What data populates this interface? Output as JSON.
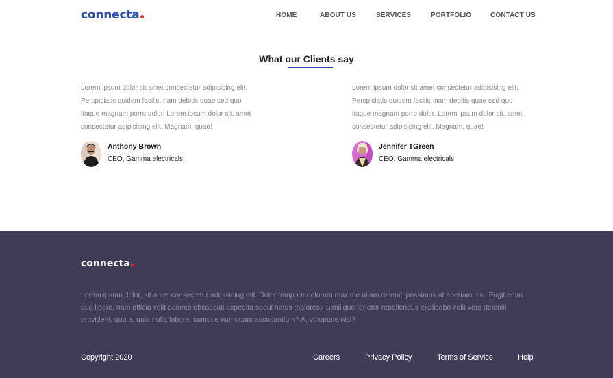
{
  "header": {
    "logo_text": "connecta",
    "nav": [
      {
        "label": "HOME"
      },
      {
        "label": "ABOUT US"
      },
      {
        "label": "SERVICES"
      },
      {
        "label": "PORTFOLIO"
      },
      {
        "label": "CONTACT US"
      }
    ]
  },
  "testimonials": {
    "title": "What our Clients say",
    "items": [
      {
        "quote": "Lorem ipsum dolor sit amet consectetur adipisicing elit. Perspiciatis quidem facilis, nam debitis quae sed quo itaque magnam porro dolor. Lorem ipsum dolor sit, amet consectetur adipisicing elit. Magnam, quae!",
        "name": "Anthony Brown",
        "role": "CEO, Gamma electricals"
      },
      {
        "quote": "Lorem ipsum dolor sit amet consectetur adipisicing elit. Perspiciatis quidem facilis, nam debitis quae sed quo itaque magnam porro dolor. Lorem ipsum dolor sit, amet consectetur adipisicing elit. Magnam, quae!",
        "name": "Jennifer TGreen",
        "role": "CEO, Gamma electricals"
      }
    ]
  },
  "footer": {
    "logo_text": "connecta",
    "text": "Lorem ipsum dolor, sit amet consectetur adipisicing elit. Dolor tempore dolorum maxime ullam deleniti possimus at aperiam nisi. Fugit enim quo libero, nam officia velit dolores obcaecati expedita sequi natus maiores? Similique tenetur repellendus explicabo velit vero deleniti provident, quo a, quia nulla labore, cumque numquam accusantium? A, voluptate nisi?",
    "copyright": "Copyright 2020",
    "links": [
      {
        "label": "Careers"
      },
      {
        "label": "Privacy Policy"
      },
      {
        "label": "Terms of Service"
      },
      {
        "label": "Help"
      }
    ]
  },
  "colors": {
    "brand": "#2a4bb0",
    "accent_dot": "#e02b2b",
    "footer_bg": "#403c57"
  }
}
